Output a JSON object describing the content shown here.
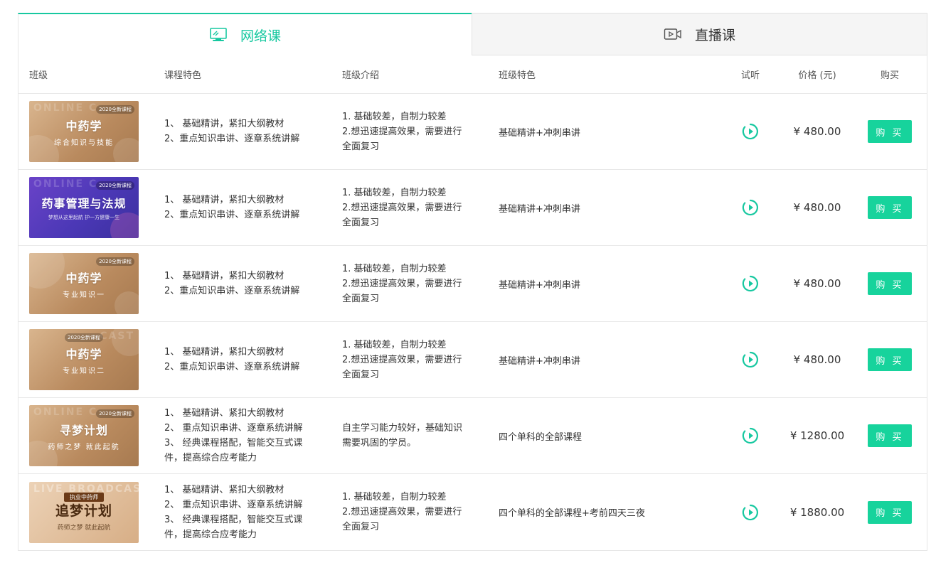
{
  "tabs": [
    {
      "label": "网络课",
      "icon": "monitor-icon",
      "active": true
    },
    {
      "label": "直播课",
      "icon": "video-icon",
      "active": false
    }
  ],
  "colors": {
    "accent": "#17c8a0",
    "buy_button": "#17d39c",
    "purple_thumb": "#4b38b6",
    "brown_thumb": "#b98a5e"
  },
  "header": {
    "class": "班级",
    "features": "课程特色",
    "intro": "班级介绍",
    "spec": "班级特色",
    "listen": "试听",
    "price": "价格 (元)",
    "buy": "购买"
  },
  "rows": [
    {
      "thumb": {
        "tag": "2020全新课程",
        "title": "中药学",
        "subtitle": "综合知识与技能",
        "style": "brown",
        "watermark": "ONLINE C"
      },
      "features": "1、 基础精讲，紧扣大纲教材\n 2、重点知识串讲、逐章系统讲解",
      "intro": "1. 基础较差，自制力较差\n 2.想迅速提高效果，需要进行全面复习",
      "spec": "基础精讲+冲刺串讲",
      "price": "¥ 480.00",
      "buy": "购 买"
    },
    {
      "thumb": {
        "tag": "2020全新课程",
        "title": "药事管理与法规",
        "subtitle": "梦想从这里起航 护一方健康一生",
        "style": "purple",
        "watermark": "ONLINE C"
      },
      "features": " 1、 基础精讲，紧扣大纲教材\n 2、重点知识串讲、逐章系统讲解",
      "intro": "1. 基础较差，自制力较差\n 2.想迅速提高效果，需要进行全面复习",
      "spec": "基础精讲+冲刺串讲",
      "price": "¥ 480.00",
      "buy": "购 买"
    },
    {
      "thumb": {
        "tag": "2020全新课程",
        "title": "中药学",
        "subtitle": "专业知识一",
        "style": "brown",
        "watermark": ""
      },
      "features": "1、 基础精讲，紧扣大纲教材\n 2、重点知识串讲、逐章系统讲解",
      "intro": "1. 基础较差，自制力较差\n 2.想迅速提高效果，需要进行全面复习",
      "spec": "基础精讲+冲刺串讲",
      "price": "¥ 480.00",
      "buy": "购 买"
    },
    {
      "thumb": {
        "tag": "2020全新课程",
        "title": "中药学",
        "subtitle": "专业知识二",
        "style": "brown",
        "watermark": "CAST"
      },
      "features": "1、 基础精讲，紧扣大纲教材\n 2、重点知识串讲、逐章系统讲解",
      "intro": "1. 基础较差，自制力较差\n 2.想迅速提高效果，需要进行全面复习",
      "spec": "基础精讲+冲刺串讲",
      "price": "¥ 480.00",
      "buy": "购 买"
    },
    {
      "thumb": {
        "tag": "2020全新课程",
        "title": "寻梦计划",
        "subtitle": "药师之梦 就此起航",
        "style": "brown",
        "watermark": "ONLINE C"
      },
      "features": "1、 基础精讲、紧扣大纲教材\n2、 重点知识串讲、逐章系统讲解\n3、 经典课程搭配，智能交互式课件，提高综合应考能力",
      "intro": "自主学习能力较好，基础知识需要巩固的学员。",
      "spec": "四个单科的全部课程",
      "price": "¥ 1280.00",
      "buy": "购 买"
    },
    {
      "thumb": {
        "tag": "执业中药师",
        "title": "追梦计划",
        "subtitle": "药师之梦 就此起航",
        "style": "light",
        "watermark": "LIVE BROADCAST"
      },
      "features": "1、 基础精讲、紧扣大纲教材\n2、 重点知识串讲、逐章系统讲解\n3、 经典课程搭配，智能交互式课件，提高综合应考能力",
      "intro": "1. 基础较差，自制力较差\n 2.想迅速提高效果，需要进行全面复习",
      "spec": "四个单科的全部课程+考前四天三夜",
      "price": "¥ 1880.00",
      "buy": "购 买"
    }
  ]
}
